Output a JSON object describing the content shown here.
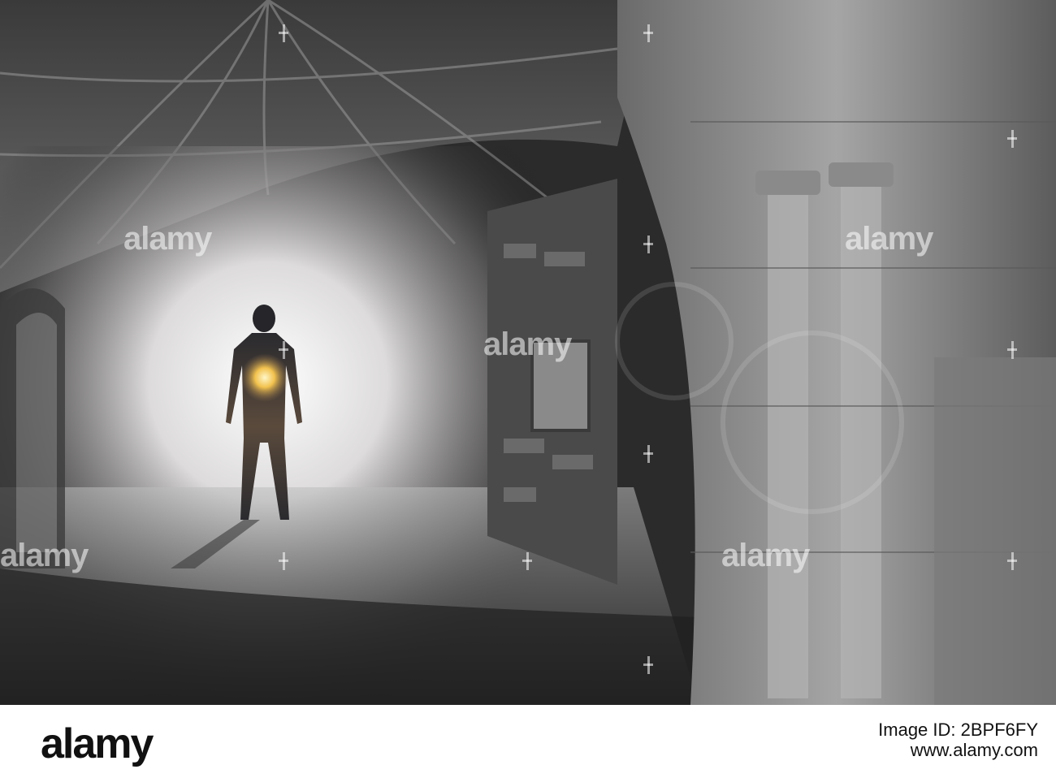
{
  "watermark": {
    "text": "alamy"
  },
  "footer": {
    "logo_text": "alamy",
    "image_id_line": "Image ID: 2BPF6FY",
    "url": "www.alamy.com"
  },
  "scene": {
    "subject": "silhouette-figure-with-galaxy-glow",
    "setting": "gothic-vaulted-cloister"
  },
  "colors": {
    "glow": "#ffffff",
    "stone": "#8a8a8a",
    "shadow": "#1a1a1a",
    "core_glow": "#f2c24e",
    "galaxy": "#8a6a4a"
  }
}
